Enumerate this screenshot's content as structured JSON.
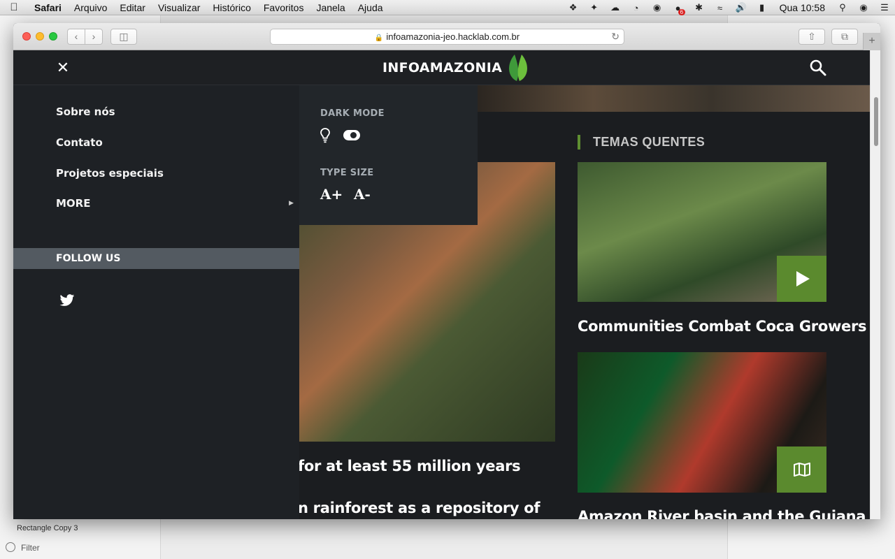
{
  "os_menubar": {
    "app_name": "Safari",
    "menus": [
      "Arquivo",
      "Editar",
      "Visualizar",
      "Histórico",
      "Favoritos",
      "Janela",
      "Ajuda"
    ],
    "clock": "Qua 10:58",
    "notification_count": "6"
  },
  "background_app": {
    "layer_label": "Rectangle Copy 3",
    "filter_label": "Filter"
  },
  "browser": {
    "url": "infoamazonia-jeo.hacklab.com.br",
    "new_tab_label": "+"
  },
  "site": {
    "logo_text": "INFOAMAZONIA",
    "colors": {
      "accent": "#5b8a2e",
      "background": "#1b1d20",
      "menu_bg": "#1e2125",
      "follow_bar": "#535a61"
    }
  },
  "side_menu": {
    "items": [
      {
        "label": "Sobre nós"
      },
      {
        "label": "Contato"
      },
      {
        "label": "Projetos especiais"
      }
    ],
    "more_label": "MORE",
    "follow_label": "FOLLOW US",
    "social": [
      "twitter-icon"
    ]
  },
  "settings": {
    "dark_mode_label": "DARK MODE",
    "dark_mode_on": true,
    "type_size_label": "TYPE SIZE",
    "increase_label": "A+",
    "decrease_label": "A-"
  },
  "content": {
    "section_title": "TEMAS QUENTES",
    "main_headline_line1": "for at least 55 million years",
    "main_headline_line2": "n rainforest as a repository of",
    "cards": [
      {
        "title": "Communities Combat Coca Growers",
        "badge": "play-icon"
      },
      {
        "title": "Amazon River basin and the Guiana",
        "badge": "map-icon"
      }
    ]
  }
}
